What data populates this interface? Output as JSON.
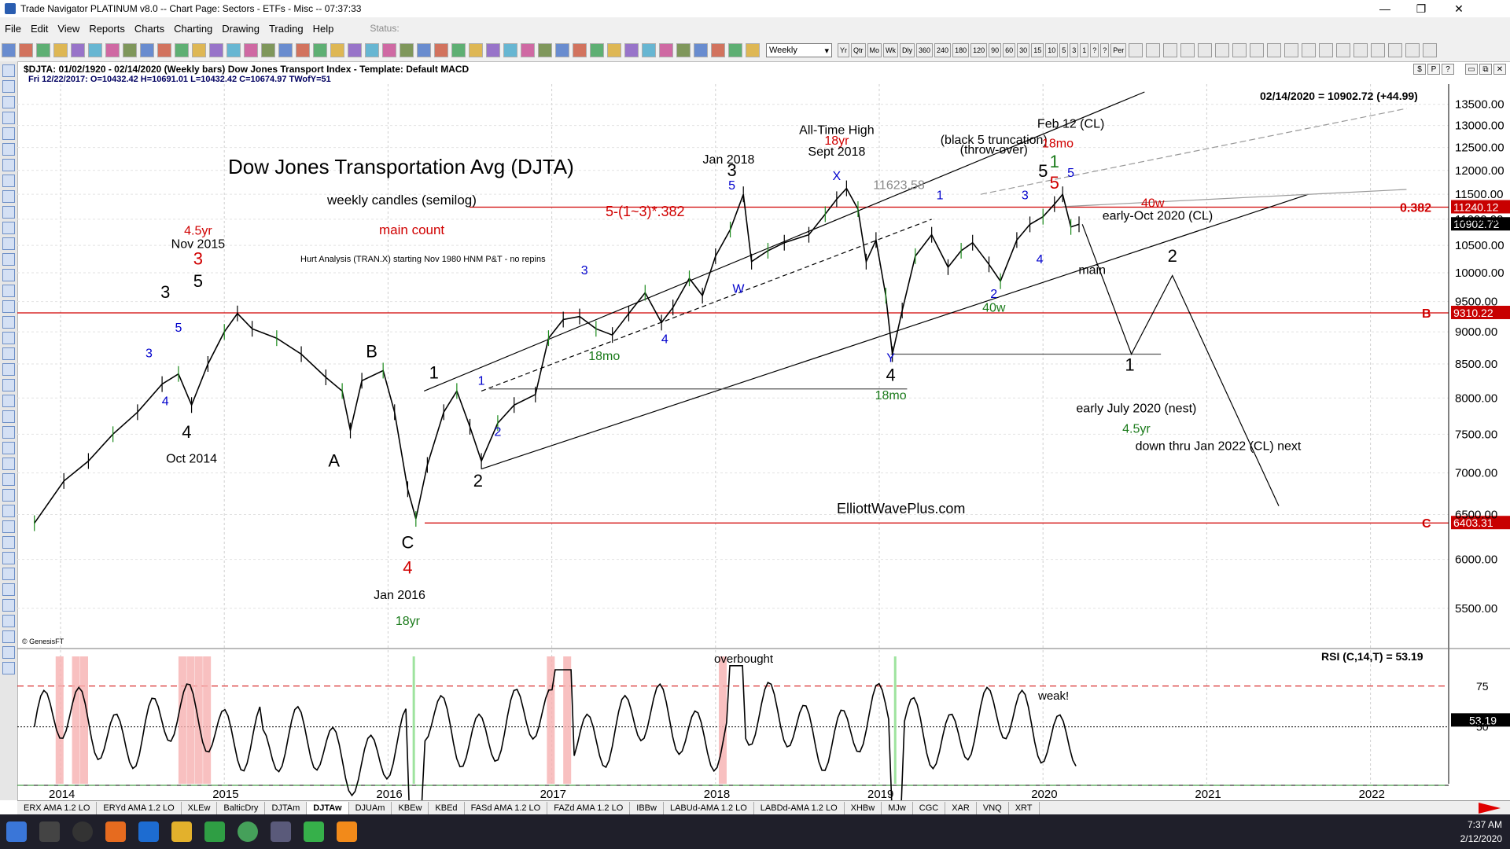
{
  "window": {
    "title": "Trade Navigator PLATINUM v8.0  --  Chart Page: Sectors - ETFs - Misc  --  07:37:33",
    "minimize": "—",
    "restore": "❐",
    "close": "✕"
  },
  "menu": {
    "items": [
      "File",
      "Edit",
      "View",
      "Reports",
      "Charts",
      "Charting",
      "Drawing",
      "Trading",
      "Help"
    ],
    "status_label": "Status:"
  },
  "toolbar": {
    "period_select": "Weekly",
    "period_buttons": [
      "Yr",
      "Qtr",
      "Mo",
      "Wk",
      "Dly",
      "360",
      "240",
      "180",
      "120",
      "90",
      "60",
      "30",
      "15",
      "10",
      "5",
      "3",
      "1",
      "?",
      "?",
      "Per"
    ]
  },
  "chart_header": {
    "line1": "$DJTA:  01/02/1920 - 02/14/2020  (Weekly bars)    Dow Jones Transport Index   -   Template: Default MACD",
    "line2": "Fri    12/22/2017:  O=10432.42  H=10691.01  L=10432.42  C=10674.97  TWofY=51",
    "right_buttons": [
      "$",
      "P",
      "?",
      "▭",
      "⧉",
      "✕"
    ]
  },
  "tabs": [
    "ERX AMA 1.2 LO",
    "ERYd AMA 1.2 LO",
    "XLEw",
    "BalticDry",
    "DJTAm",
    "DJTAw",
    "DJUAm",
    "KBEw",
    "KBEd",
    "FASd AMA 1.2 LO",
    "FAZd AMA 1.2 LO",
    "IBBw",
    "LABUd-AMA 1.2 LO",
    "LABDd-AMA 1.2 LO",
    "XHBw",
    "MJw",
    "CGC",
    "XAR",
    "VNQ",
    "XRT"
  ],
  "active_tab": "DJTAw",
  "taskbar": {
    "time": "7:37 AM",
    "date": "2/12/2020"
  },
  "chart_data": {
    "type": "line",
    "title": "Dow Jones Transportation Avg (DJTA)",
    "subtitle": "weekly candles (semilog)",
    "main_count": "main count",
    "hurst_note": "Hurt Analysis (TRAN.X) starting Nov 1980 HNM P&T - no repins",
    "watermark": "ElliottWavePlus.com",
    "source": "© GenesisFT",
    "last_value_label": "02/14/2020 = 10902.72 (+44.99)",
    "x_ticks": [
      "2014",
      "2015",
      "2016",
      "2017",
      "2018",
      "2019",
      "2020",
      "2021",
      "2022"
    ],
    "y_ticks": [
      "13500.00",
      "13000.00",
      "12500.00",
      "12000.00",
      "11500.00",
      "11000.00",
      "10500.00",
      "10000.00",
      "9500.00",
      "9000.00",
      "8500.00",
      "8000.00",
      "7500.00",
      "7000.00",
      "6500.00",
      "6000.00",
      "5500.00"
    ],
    "ylim": [
      5250,
      13800
    ],
    "price_path": [
      [
        2013.72,
        6400
      ],
      [
        2013.9,
        6900
      ],
      [
        2014.05,
        7150
      ],
      [
        2014.2,
        7500
      ],
      [
        2014.35,
        7800
      ],
      [
        2014.5,
        8200
      ],
      [
        2014.6,
        8350
      ],
      [
        2014.68,
        7900
      ],
      [
        2014.78,
        8500
      ],
      [
        2014.88,
        9000
      ],
      [
        2014.96,
        9300
      ],
      [
        2015.05,
        9050
      ],
      [
        2015.2,
        8900
      ],
      [
        2015.35,
        8650
      ],
      [
        2015.5,
        8300
      ],
      [
        2015.6,
        8100
      ],
      [
        2015.65,
        7550
      ],
      [
        2015.72,
        8250
      ],
      [
        2015.85,
        8400
      ],
      [
        2015.92,
        7800
      ],
      [
        2016.0,
        6800
      ],
      [
        2016.05,
        6450
      ],
      [
        2016.12,
        7100
      ],
      [
        2016.22,
        7800
      ],
      [
        2016.3,
        8100
      ],
      [
        2016.38,
        7600
      ],
      [
        2016.45,
        7150
      ],
      [
        2016.55,
        7650
      ],
      [
        2016.65,
        7900
      ],
      [
        2016.78,
        8050
      ],
      [
        2016.86,
        8900
      ],
      [
        2016.95,
        9200
      ],
      [
        2017.05,
        9250
      ],
      [
        2017.15,
        9050
      ],
      [
        2017.25,
        8950
      ],
      [
        2017.35,
        9300
      ],
      [
        2017.45,
        9650
      ],
      [
        2017.55,
        9150
      ],
      [
        2017.62,
        9400
      ],
      [
        2017.72,
        9900
      ],
      [
        2017.8,
        9600
      ],
      [
        2017.88,
        10300
      ],
      [
        2017.97,
        10800
      ],
      [
        2018.05,
        11500
      ],
      [
        2018.1,
        10200
      ],
      [
        2018.2,
        10400
      ],
      [
        2018.3,
        10550
      ],
      [
        2018.45,
        10700
      ],
      [
        2018.55,
        11100
      ],
      [
        2018.62,
        11400
      ],
      [
        2018.68,
        11623
      ],
      [
        2018.75,
        11200
      ],
      [
        2018.8,
        10200
      ],
      [
        2018.86,
        10600
      ],
      [
        2018.92,
        9600
      ],
      [
        2018.96,
        8650
      ],
      [
        2019.02,
        9350
      ],
      [
        2019.1,
        10300
      ],
      [
        2019.2,
        10700
      ],
      [
        2019.3,
        10100
      ],
      [
        2019.38,
        10400
      ],
      [
        2019.45,
        10550
      ],
      [
        2019.55,
        10150
      ],
      [
        2019.62,
        9850
      ],
      [
        2019.72,
        10600
      ],
      [
        2019.8,
        10900
      ],
      [
        2019.88,
        11050
      ],
      [
        2019.95,
        11300
      ],
      [
        2020.0,
        11500
      ],
      [
        2020.05,
        10850
      ],
      [
        2020.1,
        10902
      ]
    ],
    "horizontal_levels": [
      {
        "value": 11240.12,
        "label": "0.382",
        "tag": "11240.12"
      },
      {
        "value": 9310.22,
        "label": "B",
        "tag": "9310.22"
      },
      {
        "value": 6403.31,
        "label": "C",
        "tag": "6403.31"
      }
    ],
    "current_price_tag": "10902.72",
    "fib_label": "5-(1~3)*.382",
    "projected_path": [
      [
        2020.12,
        10902
      ],
      [
        2020.42,
        8650
      ],
      [
        2020.67,
        9950
      ],
      [
        2021.32,
        6600
      ]
    ],
    "annotations": [
      {
        "text": "4.5yr",
        "color": "#d00000",
        "x": 2014.72,
        "y": 10700
      },
      {
        "text": "Nov 2015",
        "color": "#000",
        "x": 2014.72,
        "y": 10450
      },
      {
        "text": "3",
        "color": "#d00000",
        "x": 2014.72,
        "y": 10150,
        "big": true
      },
      {
        "text": "5",
        "color": "#000",
        "x": 2014.72,
        "y": 9750,
        "big": true
      },
      {
        "text": "3",
        "color": "#000",
        "x": 2014.52,
        "y": 9560,
        "big": true
      },
      {
        "text": "3",
        "color": "#0000cc",
        "x": 2014.42,
        "y": 8600
      },
      {
        "text": "5",
        "color": "#0000cc",
        "x": 2014.6,
        "y": 9000
      },
      {
        "text": "4",
        "color": "#0000cc",
        "x": 2014.52,
        "y": 7900
      },
      {
        "text": "4",
        "color": "#000",
        "x": 2014.65,
        "y": 7450,
        "big": true
      },
      {
        "text": "Oct 2014",
        "color": "#000",
        "x": 2014.68,
        "y": 7130
      },
      {
        "text": "B",
        "color": "#000",
        "x": 2015.78,
        "y": 8600,
        "big": true
      },
      {
        "text": "A",
        "color": "#000",
        "x": 2015.55,
        "y": 7080,
        "big": true
      },
      {
        "text": "C",
        "color": "#000",
        "x": 2016.0,
        "y": 6120,
        "big": true
      },
      {
        "text": "4",
        "color": "#d00000",
        "x": 2016.0,
        "y": 5850,
        "big": true
      },
      {
        "text": "Jan 2016",
        "color": "#000",
        "x": 2015.95,
        "y": 5590
      },
      {
        "text": "18yr",
        "color": "#1a7a1a",
        "x": 2016.0,
        "y": 5340
      },
      {
        "text": "1",
        "color": "#000",
        "x": 2016.16,
        "y": 8280,
        "big": true
      },
      {
        "text": "1",
        "color": "#0000cc",
        "x": 2016.45,
        "y": 8190
      },
      {
        "text": "2",
        "color": "#0000cc",
        "x": 2016.55,
        "y": 7480
      },
      {
        "text": "2",
        "color": "#000",
        "x": 2016.43,
        "y": 6830,
        "big": true
      },
      {
        "text": "3",
        "color": "#0000cc",
        "x": 2017.08,
        "y": 9970
      },
      {
        "text": "4",
        "color": "#0000cc",
        "x": 2017.57,
        "y": 8820
      },
      {
        "text": "18mo",
        "color": "#1a7a1a",
        "x": 2017.2,
        "y": 8560
      },
      {
        "text": "Jan 2018",
        "color": "#000",
        "x": 2017.96,
        "y": 12150
      },
      {
        "text": "3",
        "color": "#000",
        "x": 2017.98,
        "y": 11880,
        "big": true
      },
      {
        "text": "5",
        "color": "#0000cc",
        "x": 2017.98,
        "y": 11600
      },
      {
        "text": "W",
        "color": "#0000cc",
        "x": 2018.02,
        "y": 9650
      },
      {
        "text": "All-Time High",
        "color": "#000",
        "x": 2018.62,
        "y": 12800
      },
      {
        "text": "18yr",
        "color": "#d00000",
        "x": 2018.62,
        "y": 12560
      },
      {
        "text": "Sept 2018",
        "color": "#000",
        "x": 2018.62,
        "y": 12320
      },
      {
        "text": "X",
        "color": "#0000cc",
        "x": 2018.62,
        "y": 11800
      },
      {
        "text": "11623.58",
        "color": "#888888",
        "x": 2019.0,
        "y": 11610
      },
      {
        "text": "Y",
        "color": "#0000cc",
        "x": 2018.95,
        "y": 8530
      },
      {
        "text": "4",
        "color": "#000",
        "x": 2018.95,
        "y": 8250,
        "big": true
      },
      {
        "text": "18mo",
        "color": "#1a7a1a",
        "x": 2018.95,
        "y": 7980
      },
      {
        "text": "1",
        "color": "#0000cc",
        "x": 2019.25,
        "y": 11400
      },
      {
        "text": "3",
        "color": "#0000cc",
        "x": 2019.77,
        "y": 11400
      },
      {
        "text": "2",
        "color": "#0000cc",
        "x": 2019.58,
        "y": 9560
      },
      {
        "text": "40w",
        "color": "#1a7a1a",
        "x": 2019.58,
        "y": 9330
      },
      {
        "text": "4",
        "color": "#0000cc",
        "x": 2019.86,
        "y": 10170
      },
      {
        "text": "(black 5 truncation)",
        "color": "#000",
        "x": 2019.58,
        "y": 12580
      },
      {
        "text": "(throw-over)",
        "color": "#000",
        "x": 2019.58,
        "y": 12360
      },
      {
        "text": "Feb 12 (CL)",
        "color": "#000",
        "x": 2020.05,
        "y": 12950
      },
      {
        "text": "18mo",
        "color": "#d00000",
        "x": 2019.97,
        "y": 12500
      },
      {
        "text": "5",
        "color": "#000",
        "x": 2019.88,
        "y": 11860,
        "big": true
      },
      {
        "text": "1",
        "color": "#1a7a1a",
        "x": 2019.95,
        "y": 12060,
        "big": true
      },
      {
        "text": "5",
        "color": "#d00000",
        "x": 2019.95,
        "y": 11620,
        "big": true
      },
      {
        "text": "5",
        "color": "#0000cc",
        "x": 2020.05,
        "y": 11860
      },
      {
        "text": "40w",
        "color": "#d00000",
        "x": 2020.55,
        "y": 11240
      },
      {
        "text": "early-Oct 2020 (CL)",
        "color": "#000",
        "x": 2020.58,
        "y": 10990
      },
      {
        "text": "2",
        "color": "#000",
        "x": 2020.67,
        "y": 10200,
        "big": true
      },
      {
        "text": "main",
        "color": "#000",
        "x": 2020.18,
        "y": 9980
      },
      {
        "text": "1",
        "color": "#000",
        "x": 2020.41,
        "y": 8400,
        "big": true
      },
      {
        "text": "early July 2020 (nest)",
        "color": "#000",
        "x": 2020.45,
        "y": 7800
      },
      {
        "text": "4.5yr",
        "color": "#1a7a1a",
        "x": 2020.45,
        "y": 7520
      },
      {
        "text": "down thru Jan 2022 (CL) next",
        "color": "#000",
        "x": 2020.95,
        "y": 7290
      }
    ]
  },
  "rsi": {
    "label": "RSI (C,14,T) = 53.19",
    "value_tag": "53.19",
    "levels": [
      "75",
      "50"
    ],
    "overbought_label": "overbought",
    "weak_label": "weak!"
  }
}
